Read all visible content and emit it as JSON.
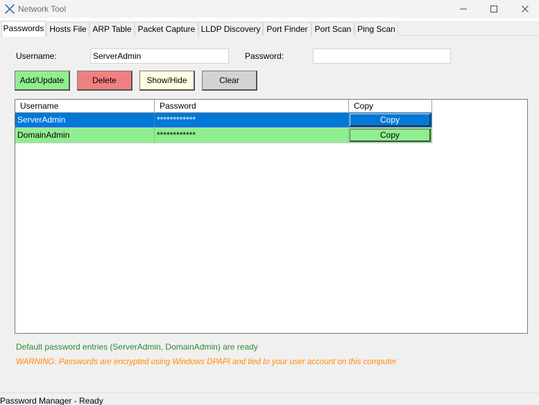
{
  "window": {
    "title": "Network Tool",
    "controls": {
      "minimize_icon": "minimize-icon",
      "maximize_icon": "maximize-icon",
      "close_icon": "close-icon"
    }
  },
  "tabs": [
    {
      "label": "Passwords",
      "active": true
    },
    {
      "label": "Hosts File",
      "active": false
    },
    {
      "label": "ARP Table",
      "active": false
    },
    {
      "label": "Packet Capture",
      "active": false
    },
    {
      "label": "LLDP Discovery",
      "active": false
    },
    {
      "label": "Port Finder",
      "active": false
    },
    {
      "label": "Port Scan",
      "active": false
    },
    {
      "label": "Ping Scan",
      "active": false
    }
  ],
  "form": {
    "username_label": "Username:",
    "username_value": "ServerAdmin",
    "password_label": "Password:",
    "password_value": ""
  },
  "buttons": {
    "add_update": {
      "label": "Add/Update",
      "color": "#90ee90"
    },
    "delete": {
      "label": "Delete",
      "color": "#f08080"
    },
    "show_hide": {
      "label": "Show/Hide",
      "color": "#ffffe0"
    },
    "clear": {
      "label": "Clear",
      "color": "#d3d3d3"
    }
  },
  "grid": {
    "columns": [
      "Username",
      "Password",
      "Copy"
    ],
    "rows": [
      {
        "username": "ServerAdmin",
        "password": "************",
        "copy_label": "Copy",
        "selected": true
      },
      {
        "username": "DomainAdmin",
        "password": "************",
        "copy_label": "Copy",
        "selected": false
      }
    ]
  },
  "messages": {
    "ready": "Default password entries (ServerAdmin, DomainAdmin) are ready",
    "warning": "WARNING: Passwords are encrypted using Windows DPAPI and tied to your user account on this computer"
  },
  "colors": {
    "selection": "#0078d7",
    "row_green": "#90ee90",
    "ok_text": "#2e8b2e",
    "warning_text": "#ff8c00"
  },
  "statusbar": {
    "text": "Password Manager - Ready"
  }
}
